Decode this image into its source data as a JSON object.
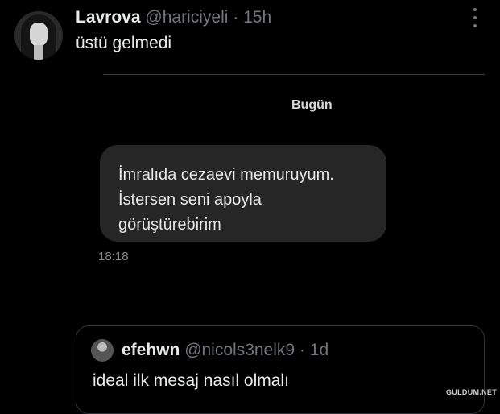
{
  "tweet": {
    "display_name": "Lavrova",
    "handle": "@hariciyeli",
    "separator": "·",
    "time": "15h",
    "text": "üstü gelmedi"
  },
  "screenshot": {
    "date_separator": "Bugün",
    "message_lines": [
      "İmralıda cezaevi memuruyum.",
      "İstersen seni apoyla",
      "görüştürebirim"
    ],
    "message_time": "18:18"
  },
  "quoted_tweet": {
    "display_name": "efehwn",
    "handle": "@nicols3nelk9",
    "separator": "·",
    "time": "1d",
    "text": "ideal ilk mesaj nasıl olmalı"
  },
  "watermark": "GULDUM.NET",
  "icons": {
    "avatar": "profile-avatar",
    "more": "more-icon"
  }
}
